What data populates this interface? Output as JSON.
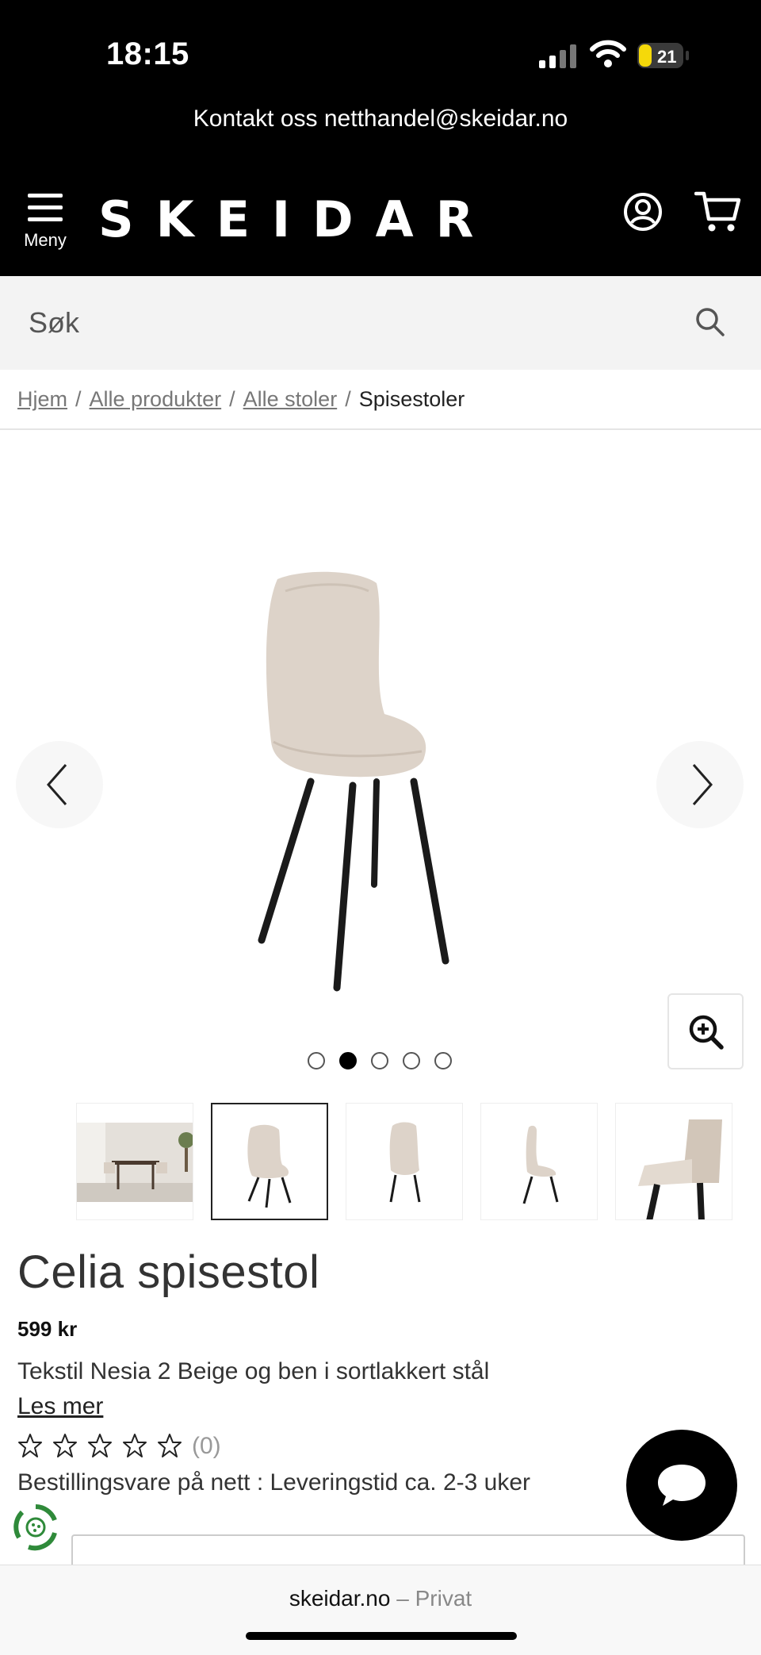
{
  "status_bar": {
    "time": "18:15",
    "battery": "21"
  },
  "contact_bar": {
    "text": "Kontakt oss netthandel@skeidar.no"
  },
  "header": {
    "menu_label": "Meny",
    "logo_text": "SKEIDAR",
    "icons": [
      "hamburger-icon",
      "account-icon",
      "cart-icon"
    ]
  },
  "search": {
    "placeholder": "Søk"
  },
  "breadcrumb": {
    "items": [
      "Hjem",
      "Alle produkter",
      "Alle stoler"
    ],
    "current": "Spisestoler",
    "separator": "/"
  },
  "gallery": {
    "image_count": 5,
    "active_index": 1,
    "chair_seat_color": "#ddd3c9",
    "chair_leg_color": "#1a1a1a"
  },
  "product": {
    "title": "Celia spisestol",
    "price": "599 kr",
    "description": "Tekstil Nesia 2 Beige og ben i sortlakkert stål",
    "read_more": "Les mer",
    "rating_stars": 0,
    "rating_max": 5,
    "rating_count": "(0)",
    "availability": "Bestillingsvare på nett : Leveringstid ca. 2-3 uker"
  },
  "browser": {
    "domain": "skeidar.no",
    "separator": " – ",
    "mode": "Privat"
  },
  "colors": {
    "header_bg": "#000000",
    "search_bg": "#f3f3f3",
    "eco_green": "#2f8a3a"
  }
}
